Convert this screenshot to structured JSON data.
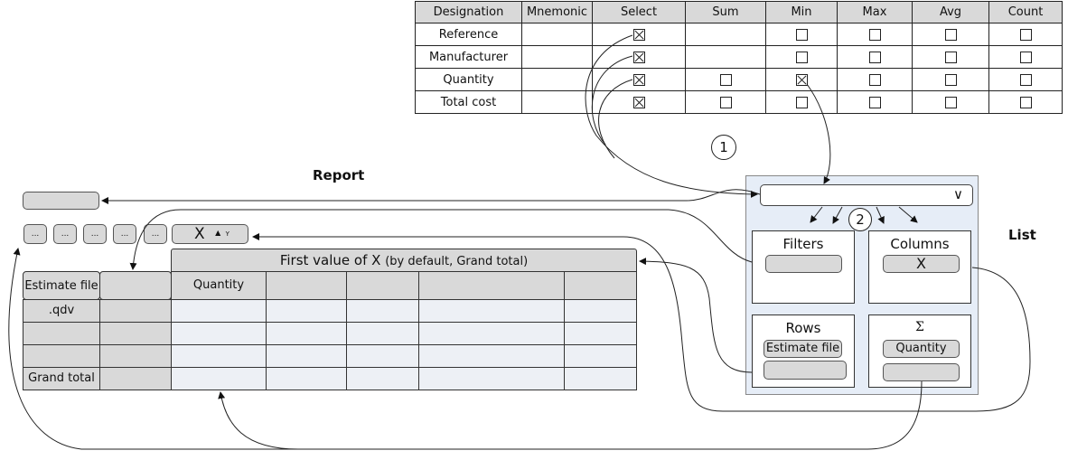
{
  "field_table": {
    "headers": [
      "Designation",
      "Mnemonic",
      "Select",
      "Sum",
      "Min",
      "Max",
      "Avg",
      "Count"
    ],
    "rows": [
      {
        "designation": "Reference",
        "mnemonic": "",
        "select": true,
        "sum": null,
        "min": false,
        "max": false,
        "avg": false,
        "count": false
      },
      {
        "designation": "Manufacturer",
        "mnemonic": "",
        "select": true,
        "sum": null,
        "min": false,
        "max": false,
        "avg": false,
        "count": false
      },
      {
        "designation": "Quantity",
        "mnemonic": "",
        "select": true,
        "sum": false,
        "min": true,
        "max": false,
        "avg": false,
        "count": false
      },
      {
        "designation": "Total cost",
        "mnemonic": "",
        "select": true,
        "sum": false,
        "min": false,
        "max": false,
        "avg": false,
        "count": false
      }
    ]
  },
  "labels": {
    "report": "Report",
    "list": "List",
    "step1": "1",
    "step2": "2"
  },
  "report": {
    "filter_buttons": [
      "...",
      "...",
      "...",
      "...",
      "..."
    ],
    "column_button": {
      "label": "X",
      "sort_arrow": "▲",
      "sort_sub": "Y"
    },
    "column_header": {
      "main": "First value of X",
      "note": "(by default, Grand total)"
    },
    "row_header": "Estimate file",
    "value_header": "Quantity",
    "row_labels": [
      ".qdv",
      "",
      "",
      "Grand total"
    ]
  },
  "list_panel": {
    "dropdown_icon": "chevron-down",
    "chevron_glyph": "∨",
    "zones": {
      "filters": {
        "title": "Filters",
        "items": [
          ""
        ]
      },
      "columns": {
        "title": "Columns",
        "items": [
          "X"
        ]
      },
      "rows": {
        "title": "Rows",
        "items": [
          "Estimate file",
          ""
        ]
      },
      "values": {
        "title": "Σ",
        "items": [
          "Quantity",
          ""
        ]
      }
    }
  }
}
